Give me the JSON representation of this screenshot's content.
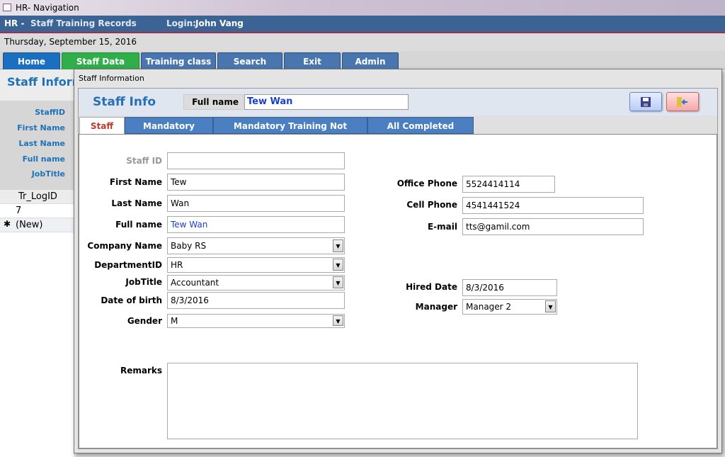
{
  "window": {
    "title": "HR- Navigation"
  },
  "header": {
    "prefix": "HR -",
    "app": "Staff Training Records",
    "login_label": "Login:",
    "login_user": "John Vang"
  },
  "date": "Thursday, September 15, 2016",
  "nav_tabs": [
    "Home",
    "Staff Data",
    "Training class",
    "Search",
    "Exit",
    "Admin"
  ],
  "background_form": {
    "title": "Staff Informa",
    "labels": [
      "StaffID",
      "First Name",
      "Last Name",
      "Full name",
      "JobTitle"
    ],
    "grid_header": "Tr_LogID",
    "rows": [
      "7",
      "(New)"
    ],
    "new_marker": "✱"
  },
  "dialog": {
    "title": "Staff Information",
    "form_title": "Staff Info",
    "fullname_label": "Full name",
    "fullname_value": "Tew Wan",
    "tabs": [
      "Staff Info",
      "Mandatory Training",
      "Mandatory Training Not Completed",
      "All Completed Trainings"
    ],
    "fields": {
      "staff_id": {
        "label": "Staff ID",
        "value": ""
      },
      "first_name": {
        "label": "First Name",
        "value": "Tew"
      },
      "last_name": {
        "label": "Last Name",
        "value": "Wan"
      },
      "full_name": {
        "label": "Full name",
        "value": "Tew Wan"
      },
      "company": {
        "label": "Company Name",
        "value": "Baby RS"
      },
      "department": {
        "label": "DepartmentID",
        "value": "HR"
      },
      "job_title": {
        "label": "JobTitle",
        "value": "Accountant"
      },
      "dob": {
        "label": "Date of birth",
        "value": "8/3/2016"
      },
      "gender": {
        "label": "Gender",
        "value": "M"
      },
      "office_phone": {
        "label": "Office Phone",
        "value": "5524414114"
      },
      "cell_phone": {
        "label": "Cell Phone",
        "value": "4541441524"
      },
      "email": {
        "label": "E-mail",
        "value": "tts@gamil.com"
      },
      "hired_date": {
        "label": "Hired Date",
        "value": "8/3/2016"
      },
      "manager": {
        "label": "Manager",
        "value": "Manager 2"
      },
      "remarks": {
        "label": "Remarks",
        "value": ""
      }
    }
  },
  "colors": {
    "header": "#3b6393",
    "home_tab": "#1a6fc0",
    "staff_data_tab": "#2fae4a",
    "tab": "#4a76b0",
    "title_blue": "#2870b5",
    "active_tab_text": "#c0392b"
  }
}
